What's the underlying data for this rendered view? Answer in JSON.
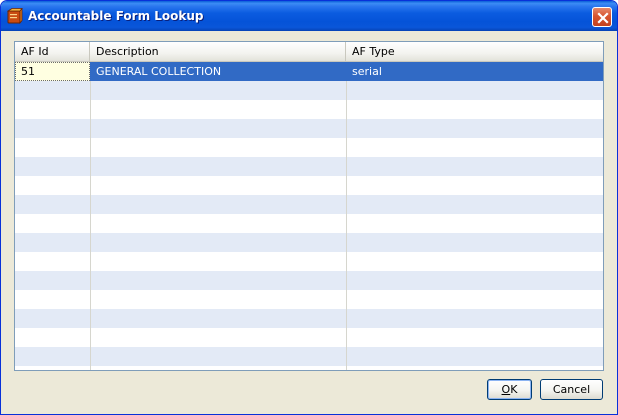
{
  "window": {
    "title": "Accountable Form Lookup"
  },
  "table": {
    "columns": [
      "AF Id",
      "Description",
      "AF Type"
    ],
    "rows": [
      [
        "51",
        "GENERAL COLLECTION",
        "serial"
      ]
    ],
    "selected_row": 0
  },
  "buttons": {
    "ok_mnemonic": "O",
    "ok_rest": "K",
    "cancel_label": "Cancel"
  },
  "colors": {
    "titlebar": "#0553D8",
    "selection": "#316AC5",
    "alt_row": "#E3EAF6",
    "window_bg": "#ECE9D8"
  },
  "icons": {
    "title": "form-lookup-icon",
    "close": "close-icon"
  }
}
